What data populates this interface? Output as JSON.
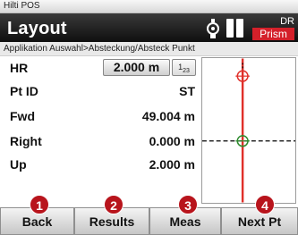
{
  "app_title": "Hilti POS",
  "header": {
    "title": "Layout",
    "mode_code": "DR",
    "mode_badge": "Prism",
    "icons": [
      "prism-icon",
      "battery-icon"
    ]
  },
  "breadcrumb": "Applikation Auswahl>Absteckung/Absteck Punkt",
  "fields": {
    "hr": {
      "label": "HR",
      "value": "2.000 m",
      "unit_toggle": "1 2 3"
    },
    "pt_id": {
      "label": "Pt ID",
      "value": "ST"
    },
    "fwd": {
      "label": "Fwd",
      "value": "49.004 m"
    },
    "right": {
      "label": "Right",
      "value": "0.000 m"
    },
    "up": {
      "label": "Up",
      "value": "2.000 m"
    }
  },
  "buttons": {
    "back": "Back",
    "results": "Results",
    "meas": "Meas",
    "next_pt": "Next Pt"
  },
  "callouts": [
    "1",
    "2",
    "3",
    "4"
  ],
  "colors": {
    "accent_red": "#d4202a",
    "target_green": "#2e8b2e",
    "header_dark": "#111111"
  }
}
